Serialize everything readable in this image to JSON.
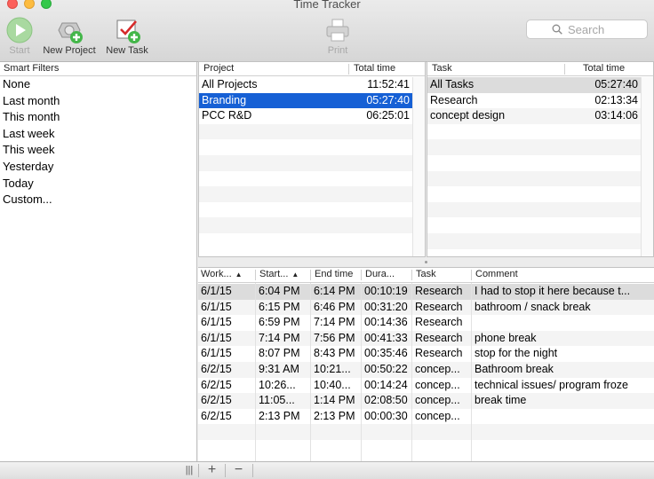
{
  "window": {
    "title": "Time Tracker"
  },
  "toolbar": {
    "start_label": "Start",
    "new_project_label": "New Project",
    "new_task_label": "New Task",
    "print_label": "Print"
  },
  "search": {
    "placeholder": "Search"
  },
  "smart_filters": {
    "header": "Smart Filters",
    "items": [
      "None",
      "Last month",
      "This month",
      "Last week",
      "This week",
      "Yesterday",
      "Today",
      "Custom..."
    ]
  },
  "projects": {
    "headers": {
      "name": "Project",
      "total": "Total time"
    },
    "rows": [
      {
        "name": "All Projects",
        "total": "11:52:41"
      },
      {
        "name": "Branding",
        "total": "05:27:40"
      },
      {
        "name": "PCC R&D",
        "total": "06:25:01"
      }
    ]
  },
  "tasks": {
    "headers": {
      "name": "Task",
      "total": "Total time"
    },
    "rows": [
      {
        "name": "All Tasks",
        "total": "05:27:40"
      },
      {
        "name": "Research",
        "total": "02:13:34"
      },
      {
        "name": "concept design",
        "total": "03:14:06"
      }
    ]
  },
  "work": {
    "headers": {
      "date": "Work...",
      "start": "Start...",
      "end": "End time",
      "duration": "Dura...",
      "task": "Task",
      "comment": "Comment"
    },
    "rows": [
      {
        "date": "6/1/15",
        "start": "6:04 PM",
        "end": "6:14 PM",
        "duration": "00:10:19",
        "task": "Research",
        "comment": "I had to stop it here because t..."
      },
      {
        "date": "6/1/15",
        "start": "6:15 PM",
        "end": "6:46 PM",
        "duration": "00:31:20",
        "task": "Research",
        "comment": "bathroom / snack break"
      },
      {
        "date": "6/1/15",
        "start": "6:59 PM",
        "end": "7:14 PM",
        "duration": "00:14:36",
        "task": "Research",
        "comment": ""
      },
      {
        "date": "6/1/15",
        "start": "7:14 PM",
        "end": "7:56 PM",
        "duration": "00:41:33",
        "task": "Research",
        "comment": "phone break"
      },
      {
        "date": "6/1/15",
        "start": "8:07 PM",
        "end": "8:43 PM",
        "duration": "00:35:46",
        "task": "Research",
        "comment": "stop for the night"
      },
      {
        "date": "6/2/15",
        "start": "9:31 AM",
        "end": "10:21...",
        "duration": "00:50:22",
        "task": "concep...",
        "comment": "Bathroom break"
      },
      {
        "date": "6/2/15",
        "start": "10:26...",
        "end": "10:40...",
        "duration": "00:14:24",
        "task": "concep...",
        "comment": "technical issues/ program froze"
      },
      {
        "date": "6/2/15",
        "start": "11:05...",
        "end": "1:14 PM",
        "duration": "02:08:50",
        "task": "concep...",
        "comment": "break time"
      },
      {
        "date": "6/2/15",
        "start": "2:13 PM",
        "end": "2:13 PM",
        "duration": "00:00:30",
        "task": "concep...",
        "comment": ""
      }
    ]
  },
  "bottombar": {
    "columns_glyph": "|||",
    "add_glyph": "+",
    "remove_glyph": "−"
  },
  "colors": {
    "selection": "#1660d5",
    "highlight": "#dcdcdc",
    "stripe": "#f4f4f4"
  }
}
